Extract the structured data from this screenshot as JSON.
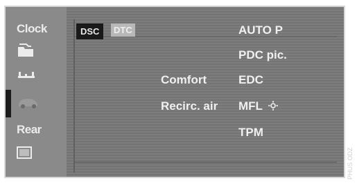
{
  "sidebar": {
    "clock": "Clock",
    "rear": "Rear"
  },
  "tabs": {
    "dsc": "DSC",
    "dtc": "DTC"
  },
  "menu": {
    "auto_p": "AUTO P",
    "pdc_pic": "PDC pic.",
    "comfort": "Comfort",
    "edc": "EDC",
    "recirc_air": "Recirc. air",
    "mfl": "MFL",
    "tpm": "TPM"
  },
  "icons": [
    "folder-icon",
    "seat-icon",
    "car-icon",
    "monitor-icon",
    "sun-icon"
  ],
  "side_code": "PHUS ODZ"
}
